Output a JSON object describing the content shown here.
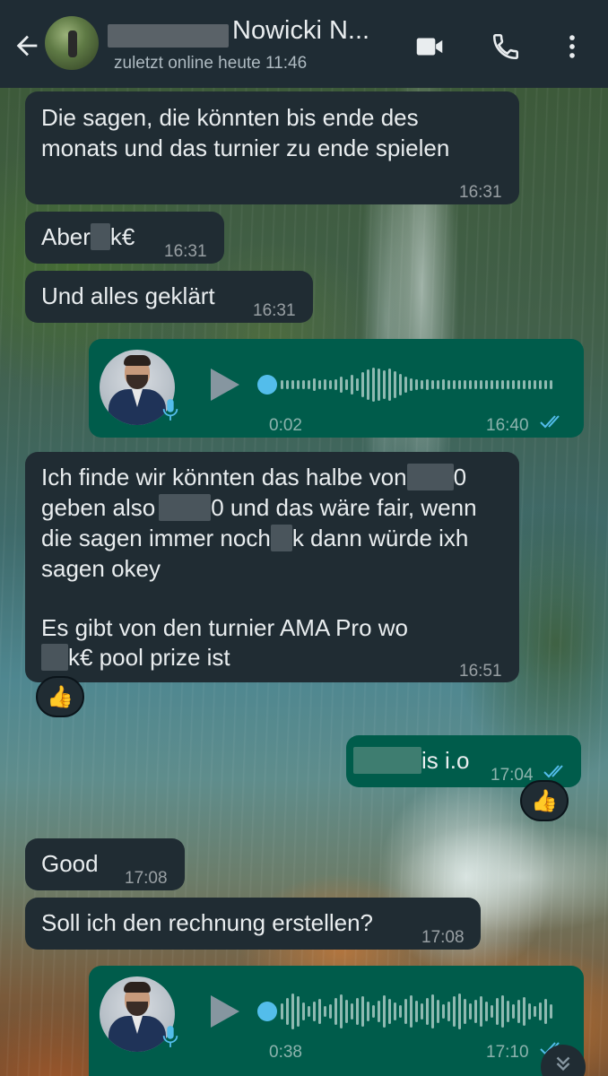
{
  "header": {
    "contact_name": "Nowicki N...",
    "last_seen": "zuletzt online heute 11:46",
    "icons": [
      "back-arrow-icon",
      "video-call-icon",
      "phone-icon",
      "more-options-icon"
    ]
  },
  "messages": [
    {
      "direction": "in",
      "lines": [
        "Die sagen, die könnten bis ende des",
        "monats und das turnier zu ende spielen"
      ],
      "time": "16:31"
    },
    {
      "direction": "in",
      "text_before": "Aber",
      "text_after": "k€",
      "time": "16:31"
    },
    {
      "direction": "in",
      "text": "Und alles geklärt",
      "time": "16:31"
    },
    {
      "direction": "out",
      "type": "voice",
      "duration": "0:02",
      "time": "16:40",
      "status": "read"
    },
    {
      "direction": "in",
      "l1a": "Ich finde wir könnten das halbe von",
      "l1b": "0",
      "l2a": "geben also",
      "l2b": "0 und das wäre fair, wenn",
      "l3a": "die sagen immer noch",
      "l3b": "k dann würde ixh",
      "l4": "sagen okey",
      "l5": "Es gibt von den turnier AMA Pro wo",
      "l6b": "k€ pool prize ist",
      "time": "16:51",
      "reaction": "👍"
    },
    {
      "direction": "out",
      "text_after": "is i.o",
      "time": "17:04",
      "status": "read",
      "reaction": "👍"
    },
    {
      "direction": "in",
      "text": "Good",
      "time": "17:08"
    },
    {
      "direction": "in",
      "text": "Soll ich den rechnung erstellen?",
      "time": "17:08"
    },
    {
      "direction": "out",
      "type": "voice",
      "duration": "0:38",
      "time": "17:10",
      "status": "read"
    }
  ],
  "colors": {
    "header_bg": "#1f2c34",
    "incoming_bubble": "#202c33",
    "outgoing_bubble": "#005c4b",
    "read_ticks": "#53bdeb"
  }
}
